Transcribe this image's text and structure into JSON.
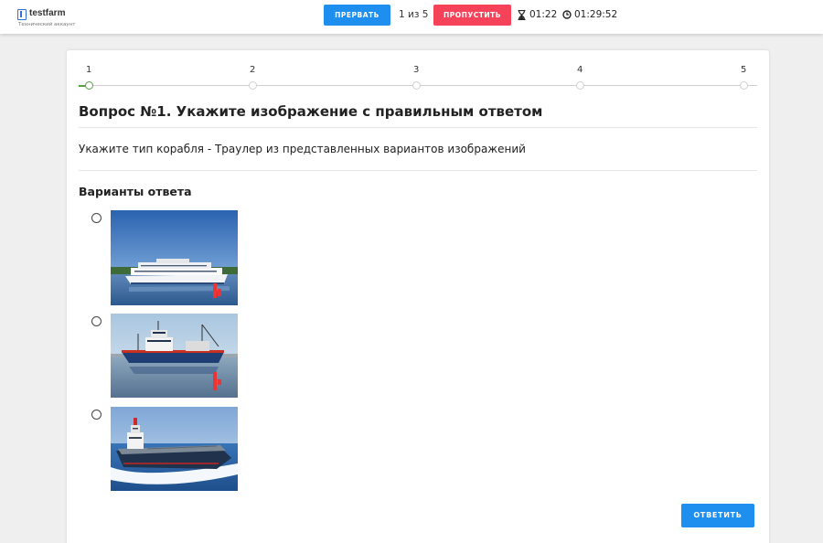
{
  "header": {
    "logo_text": "testfarm",
    "logo_subtitle": "Технический аккаунт",
    "abort_label": "ПРЕРВАТЬ",
    "question_counter": "1 из 5",
    "skip_label": "ПРОПУСТИТЬ",
    "question_timer": "01:22",
    "total_timer": "01:29:52"
  },
  "steps": {
    "labels": [
      "1",
      "2",
      "3",
      "4",
      "5"
    ],
    "current": 1
  },
  "question": {
    "title": "Вопрос №1. Укажите изображение с правильным ответом",
    "text": "Укажите тип корабля - Траулер из представленных вариантов изображений",
    "answers_heading": "Варианты ответа",
    "options": [
      {
        "image": "passenger-river-cruise-ship",
        "selected": false
      },
      {
        "image": "fishing-trawler",
        "selected": false
      },
      {
        "image": "tanker-ship",
        "selected": false
      }
    ]
  },
  "footer": {
    "answer_label": "ОТВЕТИТЬ"
  },
  "colors": {
    "primary": "#1e8fee",
    "danger": "#f6435a",
    "progress": "#5a9e45"
  }
}
